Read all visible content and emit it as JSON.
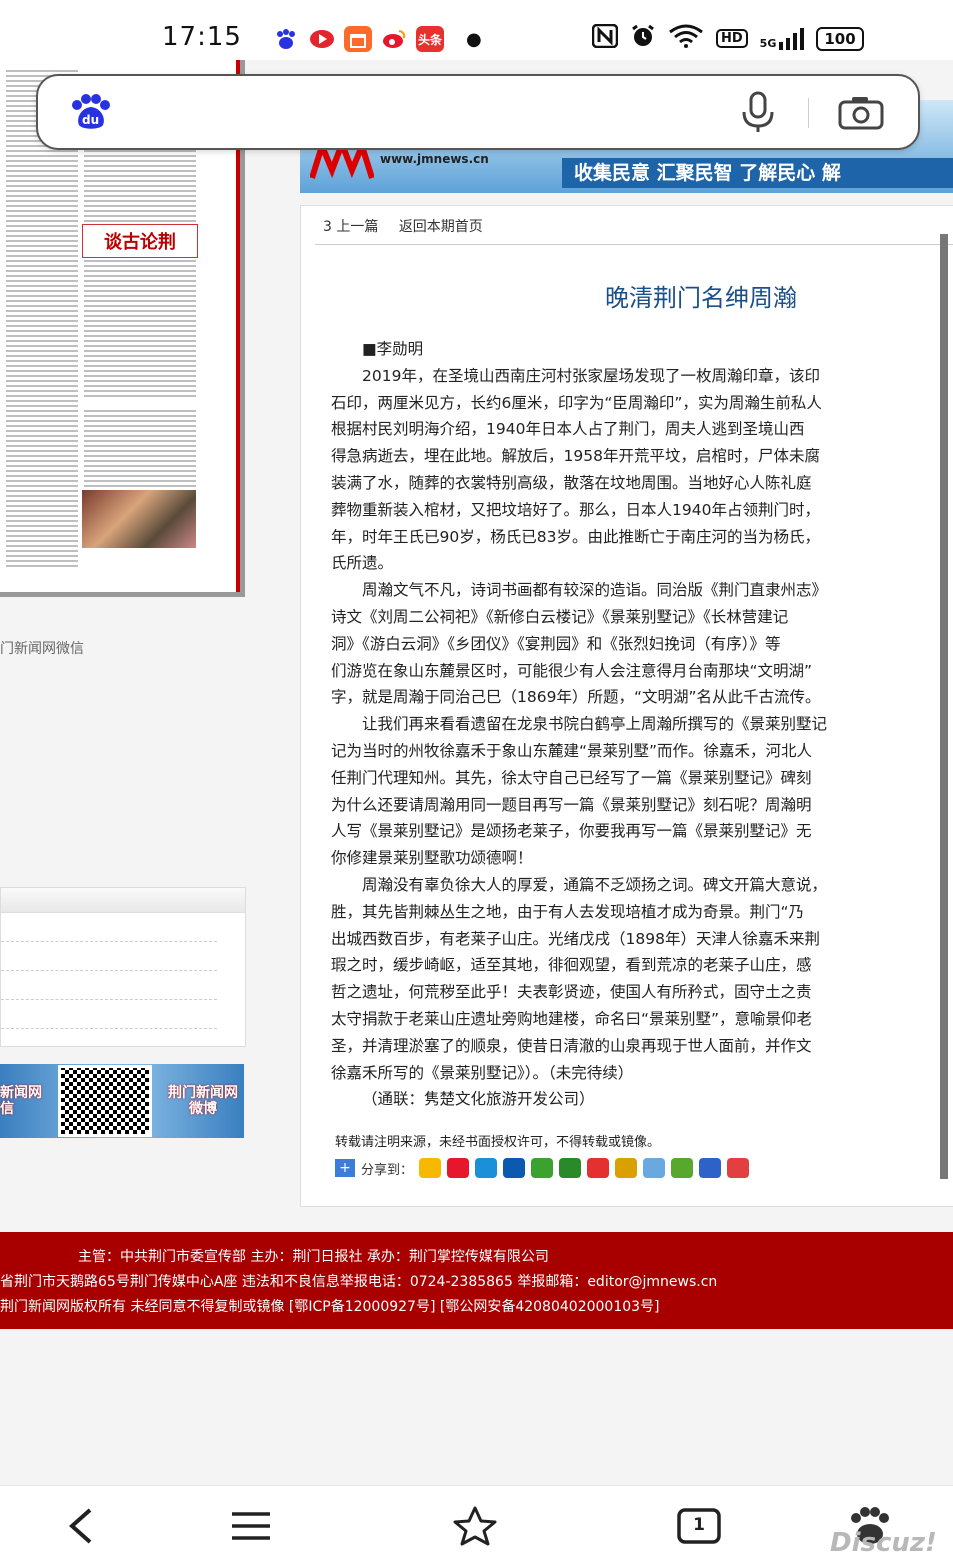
{
  "status_bar": {
    "time": "17:15",
    "app_icons": [
      "baidu-icon",
      "video-app-icon",
      "gift-app-icon",
      "weibo-icon",
      "toutiao-icon"
    ],
    "toutiao_label": "头条",
    "network": "5G",
    "hd_label": "HD",
    "battery": "100"
  },
  "search_bar": {
    "logo": "du",
    "voice_icon": "microphone-icon",
    "camera_icon": "camera-icon"
  },
  "banner": {
    "site": "www.jmnews.cn",
    "slogan": "收集民意  汇聚民智  了解民心  解"
  },
  "left_column": {
    "scan_tag": "谈古论荆",
    "wechat_label": "门新闻网微信",
    "qr_left": "新闻网\n信",
    "qr_right": "荆门新闻网\n微博"
  },
  "article": {
    "nav": {
      "prev": "3 上一篇",
      "home": "返回本期首页"
    },
    "title": "晚清荆门名绅周瀚",
    "author": "■李勋明",
    "paragraphs": [
      {
        "indent": true,
        "text": "2019年，在圣境山西南庄河村张家屋场发现了一枚周瀚印章，该印"
      },
      {
        "indent": false,
        "text": "石印，两厘米见方，长约6厘米，印字为“臣周瀚印”，实为周瀚生前私人"
      },
      {
        "indent": false,
        "text": "根据村民刘明海介绍，1940年日本人占了荆门，周夫人逃到圣境山西"
      },
      {
        "indent": false,
        "text": "得急病逝去，埋在此地。解放后，1958年开荒平坟，启棺时，尸体未腐"
      },
      {
        "indent": false,
        "text": "装满了水，随葬的衣裳特别高级，散落在坟地周围。当地好心人陈礼庭"
      },
      {
        "indent": false,
        "text": "葬物重新装入棺材，又把坟培好了。那么，日本人1940年占领荆门时，"
      },
      {
        "indent": false,
        "text": "年，时年王氏已90岁，杨氏已83岁。由此推断亡于南庄河的当为杨氏，"
      },
      {
        "indent": false,
        "text": "氏所遗。"
      },
      {
        "indent": true,
        "text": "周瀚文气不凡，诗词书画都有较深的造诣。同治版《荆门直隶州志》"
      },
      {
        "indent": false,
        "text": "诗文《刘周二公祠祀》《新修白云楼记》《景莱别墅记》《长林营建记"
      },
      {
        "indent": false,
        "text": "洞》《游白云洞》《乡团仪》《宴荆园》和《张烈妇挽词（有序）》等"
      },
      {
        "indent": false,
        "text": "们游览在象山东麓景区时，可能很少有人会注意得月台南那块“文明湖”"
      },
      {
        "indent": false,
        "text": "字，就是周瀚于同治己巳（1869年）所题，“文明湖”名从此千古流传。"
      },
      {
        "indent": true,
        "text": "让我们再来看看遗留在龙泉书院白鹤亭上周瀚所撰写的《景莱别墅记"
      },
      {
        "indent": false,
        "text": "记为当时的州牧徐嘉禾于象山东麓建“景莱别墅”而作。徐嘉禾，河北人"
      },
      {
        "indent": false,
        "text": "任荆门代理知州。其先，徐太守自己已经写了一篇《景莱别墅记》碑刻"
      },
      {
        "indent": false,
        "text": "为什么还要请周瀚用同一题目再写一篇《景莱别墅记》刻石呢？周瀚明"
      },
      {
        "indent": false,
        "text": "人写《景莱别墅记》是颂扬老莱子，你要我再写一篇《景莱别墅记》无"
      },
      {
        "indent": false,
        "text": "你修建景莱别墅歌功颂德啊！"
      },
      {
        "indent": true,
        "text": "周瀚没有辜负徐大人的厚爱，通篇不乏颂扬之词。碑文开篇大意说，"
      },
      {
        "indent": false,
        "text": "胜，其先皆荆棘丛生之地，由于有人去发现培植才成为奇景。荆门“乃"
      },
      {
        "indent": false,
        "text": "出城西数百步，有老莱子山庄。光绪戊戌（1898年）天津人徐嘉禾来荆"
      },
      {
        "indent": false,
        "text": "瑕之时，缓步崎岖，适至其地，徘徊观望，看到荒凉的老莱子山庄，感"
      },
      {
        "indent": false,
        "text": "哲之遗址，何荒秽至此乎！夫表彰贤迹，使国人有所矜式，固守土之责"
      },
      {
        "indent": false,
        "text": "太守捐款于老莱山庄遗址旁购地建楼，命名曰“景莱别墅”，意喻景仰老"
      },
      {
        "indent": false,
        "text": "圣，并清理淤塞了的顺泉，使昔日清澈的山泉再现于世人面前，并作文"
      },
      {
        "indent": false,
        "text": "徐嘉禾所写的《景莱别墅记》）。（未完待续）"
      },
      {
        "indent": true,
        "text": "（通联：隽楚文化旅游开发公司）"
      }
    ],
    "copyright": "转载请注明来源，未经书面授权许可，不得转载或镜像。",
    "share_label": "分享到："
  },
  "footer": {
    "line1": "主管：中共荆门市委宣传部    主办：荆门日报社    承办：荆门掌控传媒有限公司",
    "line2": "省荆门市天鹅路65号荆门传媒中心A座 违法和不良信息举报电话：0724-2385865 举报邮箱：editor@jmnews.cn",
    "line3": "荆门新闻网版权所有 未经同意不得复制或镜像 [鄂ICP备12000927号] [鄂公网安备42080402000103号]"
  },
  "bottom_nav": {
    "tab_count": "1",
    "watermark": "Discuz!"
  },
  "colors": {
    "footer_red": "#a80000",
    "title_blue": "#1a4f8a",
    "baidu_blue": "#2932e1"
  }
}
